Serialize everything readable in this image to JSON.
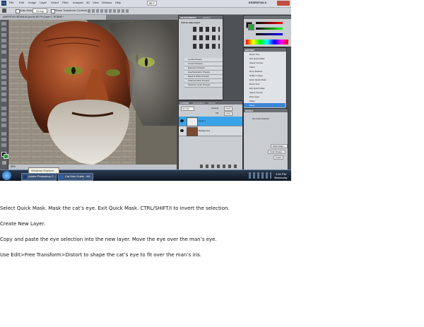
{
  "screenshot": {
    "window_title": "AMERICAN INDIAN 64.psd @ 66.7% (Layer 1, RGB/8*) *",
    "menu": [
      "File",
      "Edit",
      "Image",
      "Layer",
      "Select",
      "Filter",
      "Analysis",
      "3D",
      "View",
      "Window",
      "Help"
    ],
    "workspace": "ESSENTIALS",
    "zoom_menu": "66.7",
    "options": {
      "auto_select": "Auto-Select:",
      "group": "Group",
      "show_transform": "Show Transform Controls"
    },
    "status_zoom": "66%",
    "adjustments": {
      "tab_adjustments": "ADJUSTMENTS",
      "tab_masks": "MASKS",
      "heading": "Add an adjustment",
      "presets": [
        "Levels Presets",
        "Curves Presets",
        "Exposure Presets",
        "Hue/Saturation Presets",
        "Black & White Presets",
        "Channel Mixer Presets",
        "Selective Color Presets"
      ]
    },
    "history": {
      "tab": "HISTORY",
      "items": [
        "Brush Tool",
        "Exit Quick Mask",
        "Select Inverse",
        "Paste",
        "Drop Shadow",
        "Hidden Image",
        "Enter Quick Mask",
        "Brush Tool",
        "Exit Quick Mask",
        "Select Inverse",
        "New Layer",
        "Paste",
        "Move"
      ],
      "selected_index": 12
    },
    "layers": {
      "tabs": [
        "LAYERS",
        "CHANNELS",
        "PATHS"
      ],
      "blend_mode": "Normal",
      "opacity_label": "Opacity:",
      "opacity_value": "100%",
      "fill_label": "Fill:",
      "fill_value": "100%",
      "rows": [
        "Layer 1",
        "Background"
      ],
      "selected_index": 0
    },
    "masks": {
      "tab": "MASKS",
      "message": "No mask selected",
      "buttons": [
        "Mask Edge...",
        "Color Range...",
        "Invert"
      ]
    },
    "taskbar": {
      "start": "start",
      "tasks": [
        "Adobe Photoshop C...",
        "Cat Man Guide - Mi..."
      ],
      "tooltip": "Windows Explorer",
      "clock_time": "2:59 PM",
      "clock_day": "Wednesday"
    },
    "colors": {
      "selection_blue": "#3d86d6",
      "layer_selected": "#39a3e8",
      "panel_bg": "#c9ccd0",
      "workspace_dark": "#4a4a4a"
    }
  },
  "instructions": [
    "Select Quick Mask. Mask the cat’s eye. Exit Quick Mask. CTRL/SHIFT/I to invert the selection.",
    "Create New Layer.",
    "Copy and paste the eye selection into the new layer. Move the eye over the man’s eye.",
    "Use Edit>Free Transform>Distort to shape the cat’s eye to fit over the man’s iris."
  ]
}
